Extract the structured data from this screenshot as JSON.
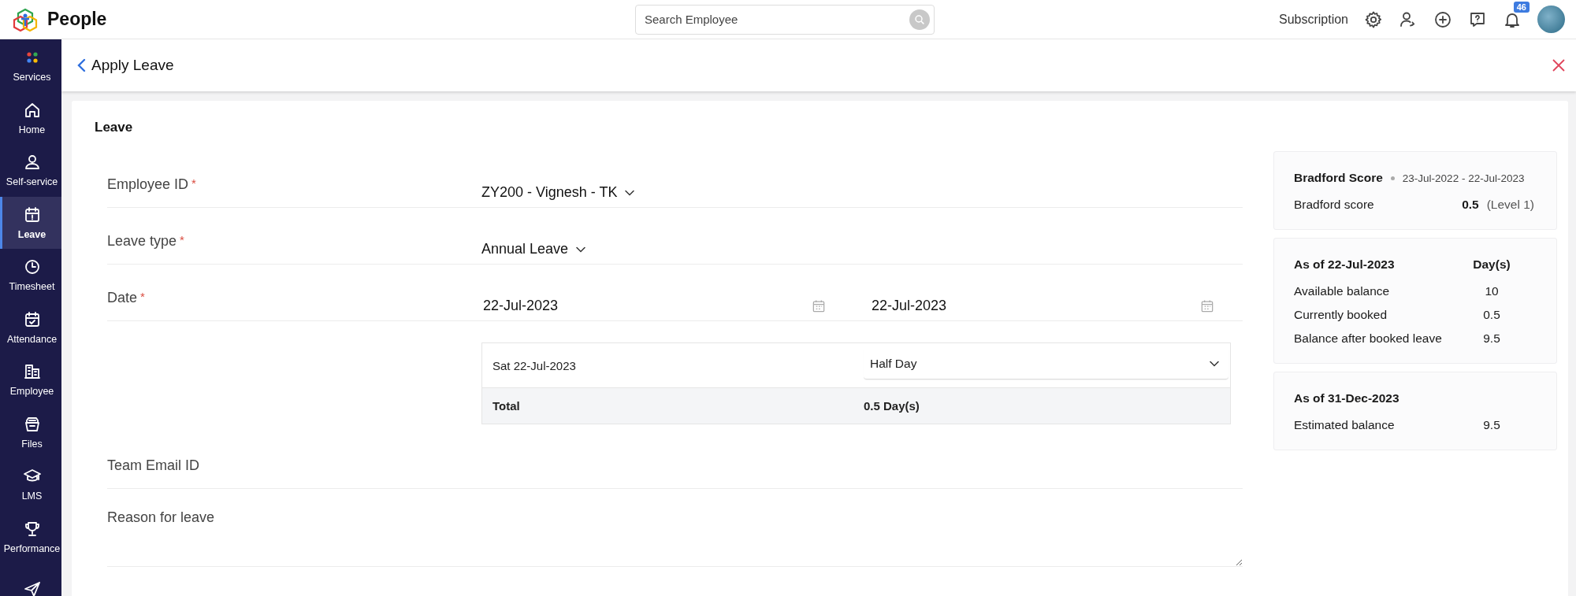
{
  "app": {
    "name": "People"
  },
  "search": {
    "placeholder": "Search Employee"
  },
  "topbar": {
    "subscription": "Subscription",
    "notifications": "46"
  },
  "sidebar": {
    "items": [
      {
        "label": "Services",
        "selected": false
      },
      {
        "label": "Home",
        "selected": false
      },
      {
        "label": "Self-service",
        "selected": false
      },
      {
        "label": "Leave",
        "selected": true
      },
      {
        "label": "Timesheet",
        "selected": false
      },
      {
        "label": "Attendance",
        "selected": false
      },
      {
        "label": "Employee",
        "selected": false
      },
      {
        "label": "Files",
        "selected": false
      },
      {
        "label": "LMS",
        "selected": false
      },
      {
        "label": "Performance",
        "selected": false
      },
      {
        "selected": false
      }
    ]
  },
  "page": {
    "title": "Apply Leave"
  },
  "form": {
    "section_title": "Leave",
    "fields": [
      {
        "kind": "select",
        "label": "Employee ID",
        "marker": "*",
        "value": "ZY200 - Vignesh - TK"
      },
      {
        "kind": "select",
        "label": "Leave type",
        "marker": "*",
        "value": "Annual Leave"
      },
      {
        "kind": "dates",
        "label": "Date",
        "marker": "*",
        "from": "22-Jul-2023",
        "to": "22-Jul-2023"
      },
      {
        "kind": "breakdown",
        "rows": [
          {
            "date": "Sat 22-Jul-2023",
            "session": "Half Day"
          }
        ],
        "total_label": "Total",
        "total_value": "0.5 Day(s)"
      },
      {
        "kind": "text",
        "label": "Team Email ID"
      },
      {
        "kind": "textarea",
        "label": "Reason for leave"
      }
    ]
  },
  "bradford": {
    "title": "Bradford Score",
    "period": "23-Jul-2022 - 22-Jul-2023",
    "label": "Bradford score",
    "score": "0.5",
    "level": "(Level 1)"
  },
  "balances": [
    {
      "title": "As of 22-Jul-2023",
      "unit": "Day(s)",
      "rows": [
        {
          "label": "Available balance",
          "value": "10"
        },
        {
          "label": "Currently booked",
          "value": "0.5"
        },
        {
          "label": "Balance after booked leave",
          "value": "9.5"
        }
      ]
    },
    {
      "title": "As of 31-Dec-2023",
      "rows": [
        {
          "label": "Estimated balance",
          "value": "9.5"
        }
      ]
    }
  ]
}
